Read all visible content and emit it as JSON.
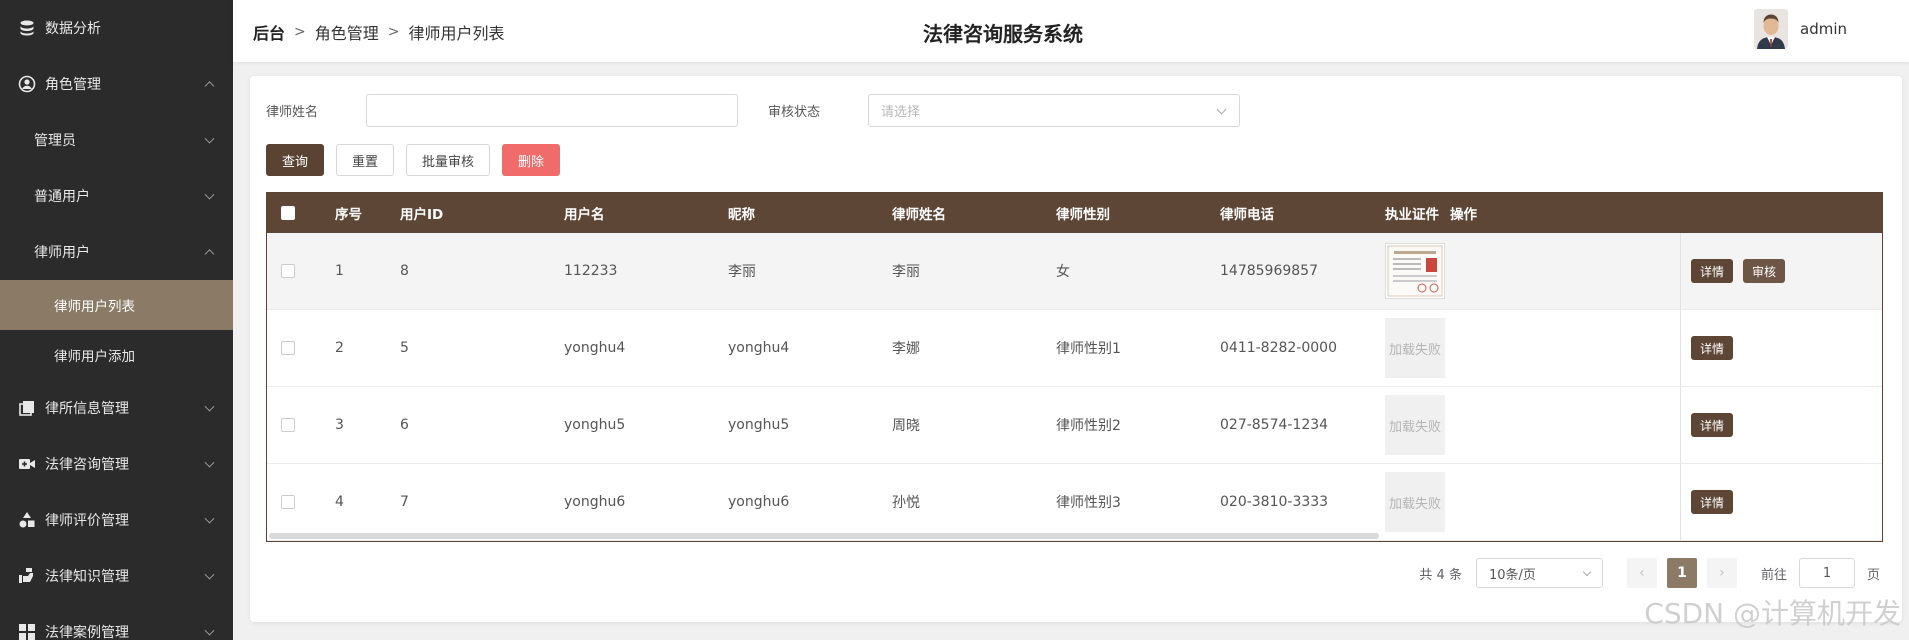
{
  "sidebar": {
    "items": [
      {
        "label": "数据分析",
        "icon": "database-icon"
      },
      {
        "label": "角色管理",
        "icon": "user-circle-icon"
      },
      {
        "label": "管理员"
      },
      {
        "label": "普通用户"
      },
      {
        "label": "律师用户"
      },
      {
        "label": "律师用户列表"
      },
      {
        "label": "律师用户添加"
      },
      {
        "label": "律所信息管理",
        "icon": "copy-icon"
      },
      {
        "label": "法律咨询管理",
        "icon": "video-plus-icon"
      },
      {
        "label": "律师评价管理",
        "icon": "shapes-icon"
      },
      {
        "label": "法律知识管理",
        "icon": "hand-icon"
      },
      {
        "label": "法律案例管理",
        "icon": "grid-icon"
      }
    ]
  },
  "header": {
    "breadcrumb": [
      "后台",
      "角色管理",
      "律师用户列表"
    ],
    "title": "法律咨询服务系统",
    "username": "admin"
  },
  "search": {
    "name_label": "律师姓名",
    "status_label": "审核状态",
    "status_placeholder": "请选择",
    "query_btn": "查询",
    "reset_btn": "重置",
    "batch_btn": "批量审核",
    "delete_btn": "删除"
  },
  "table": {
    "headers": [
      "序号",
      "用户ID",
      "用户名",
      "昵称",
      "律师姓名",
      "律师性别",
      "律师电话",
      "执业证件",
      "操作"
    ],
    "rows": [
      {
        "no": "1",
        "id": "8",
        "username": "112233",
        "nickname": "李丽",
        "name": "李丽",
        "gender": "女",
        "phone": "14785969857",
        "cert": "",
        "detail": "详情",
        "audit": "审核"
      },
      {
        "no": "2",
        "id": "5",
        "username": "yonghu4",
        "nickname": "yonghu4",
        "name": "李娜",
        "gender": "律师性别1",
        "phone": "0411-8282-0000",
        "cert": "加载失败",
        "detail": "详情"
      },
      {
        "no": "3",
        "id": "6",
        "username": "yonghu5",
        "nickname": "yonghu5",
        "name": "周晓",
        "gender": "律师性别2",
        "phone": "027-8574-1234",
        "cert": "加载失败",
        "detail": "详情"
      },
      {
        "no": "4",
        "id": "7",
        "username": "yonghu6",
        "nickname": "yonghu6",
        "name": "孙悦",
        "gender": "律师性别3",
        "phone": "020-3810-3333",
        "cert": "加载失败",
        "detail": "详情"
      }
    ]
  },
  "pagination": {
    "total": "共 4 条",
    "page_size": "10条/页",
    "current": "1",
    "goto_label": "前往",
    "goto_value": "1",
    "page_unit": "页"
  },
  "watermark": "CSDN @计算机开发",
  "colors": {
    "sidebar_bg": "#2b2b2b",
    "accent": "#5e4636",
    "active": "#8a7a66",
    "danger": "#f26b6b"
  }
}
